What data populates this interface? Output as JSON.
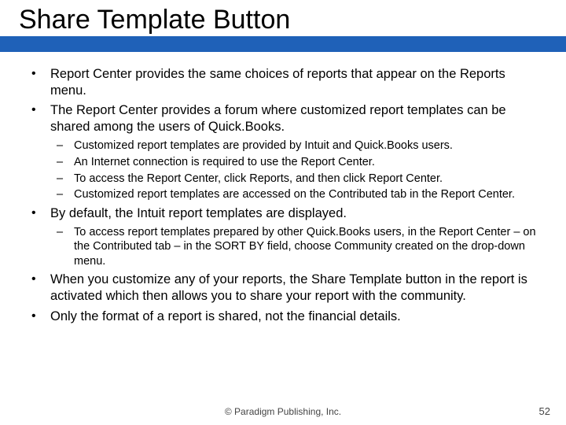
{
  "title": "Share Template Button",
  "bullets": [
    {
      "text": "Report Center provides the same choices of reports that appear on the Reports menu."
    },
    {
      "text": "The Report Center provides a forum where customized report templates can be shared among the users of Quick.Books.",
      "sub": [
        "Customized report templates are provided by Intuit and Quick.Books users.",
        "An Internet connection is required to use the Report Center.",
        "To access the Report Center, click Reports, and then click Report Center.",
        "Customized report templates are accessed on the Contributed tab in the Report Center."
      ]
    },
    {
      "text": "By default, the Intuit report templates are displayed.",
      "sub": [
        "To access report templates prepared by other Quick.Books users, in the Report Center – on the Contributed tab – in the SORT BY field, choose Community created on the drop-down menu."
      ]
    },
    {
      "text": "When you customize any of your reports, the Share Template button in the report is activated which then allows you to share your report with the community."
    },
    {
      "text": "Only the format of a report is shared, not the financial details."
    }
  ],
  "footer": "© Paradigm Publishing, Inc.",
  "page": "52"
}
